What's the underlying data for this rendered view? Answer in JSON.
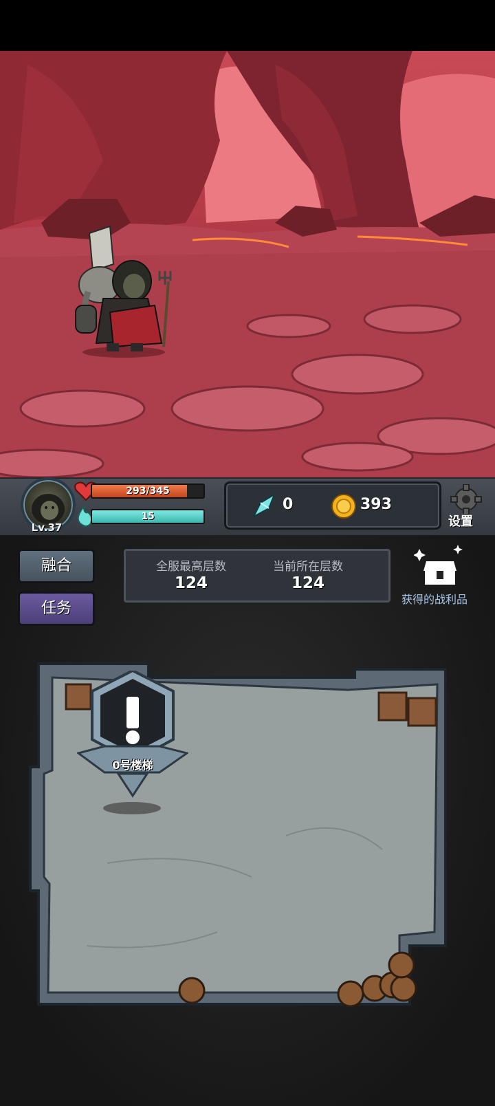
{
  "hud": {
    "level": "Lv.37",
    "hp_text": "293/345",
    "hp_fraction": 0.849,
    "mp_text": "15",
    "mp_fraction": 1.0,
    "crystal_count": "0",
    "gold_count": "393",
    "settings_label": "设置"
  },
  "panel": {
    "fuse_label": "融合",
    "task_label": "任务",
    "server_best_label": "全服最高层数",
    "server_best_value": "124",
    "current_floor_label": "当前所在层数",
    "current_floor_value": "124",
    "loot_label": "获得的战利品"
  },
  "room": {
    "stair_label": "0号楼梯"
  },
  "colors": {
    "hp": "#e0582c",
    "mp": "#5fd3cc",
    "task_button": "#5c4b8e",
    "fuse_button": "#55626e",
    "loot_text": "#a8c6e8"
  }
}
